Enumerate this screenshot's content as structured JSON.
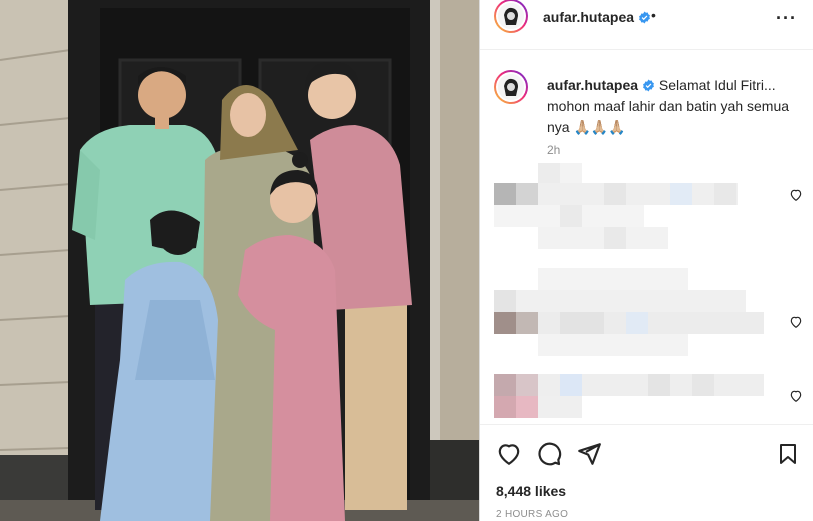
{
  "header": {
    "username": "aufar.hutapea",
    "separator": "•",
    "more_label": "···"
  },
  "caption": {
    "username": "aufar.hutapea",
    "text": "Selamat Idul Fitri... mohon maaf lahir dan batin yah semua nya 🙏🏼🙏🏼🙏🏼",
    "time": "2h"
  },
  "comments": [
    {
      "kind": "blurred"
    },
    {
      "kind": "blurred"
    },
    {
      "kind": "blurred"
    }
  ],
  "actions": {
    "likes": "8,448 likes",
    "posted": "2 HOURS AGO"
  },
  "colors": {
    "verified_blue": "#3897f0",
    "mint_outfit": "#8fd1b5",
    "pink_outfit": "#cf8c99",
    "blue_outfit": "#9fbfe0",
    "sage_outfit": "#a9a88b"
  },
  "icons": [
    "verified-icon",
    "more-icon",
    "heart-icon",
    "comment-icon",
    "share-icon",
    "bookmark-icon"
  ]
}
